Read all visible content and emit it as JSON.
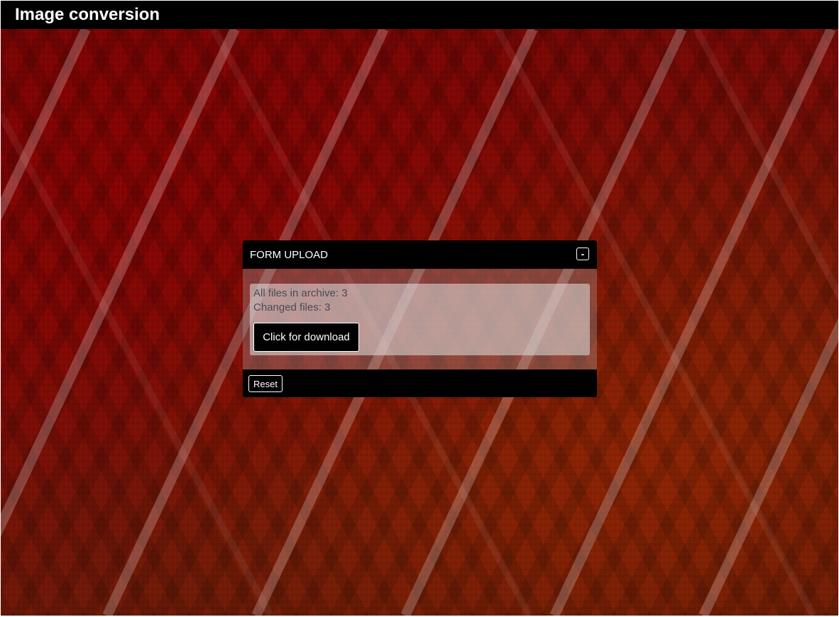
{
  "header": {
    "title": "Image conversion"
  },
  "panel": {
    "title": "FORM UPLOAD",
    "collapse_label": "-",
    "info": {
      "all_files": "All files in archive: 3",
      "changed_files": "Changed files: 3"
    },
    "download_label": "Click for download",
    "reset_label": "Reset"
  },
  "colors": {
    "topbar": "#000000",
    "background": "#6a0606",
    "stripe": "#ffffff",
    "text_muted": "#4a4a58"
  }
}
